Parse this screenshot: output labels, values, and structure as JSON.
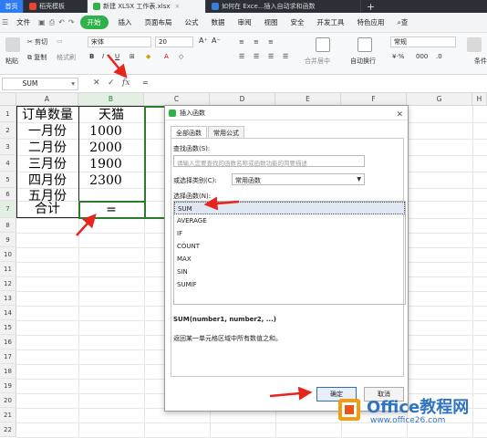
{
  "tabs": {
    "home": "首页",
    "templates": "稻壳模板",
    "workbook": "新建 XLSX 工作表.xlsx",
    "doc": "如何在 Exce...插入自动求和函数",
    "plus": "+"
  },
  "menu": {
    "file": "文件",
    "start": "开始",
    "items": [
      "插入",
      "页面布局",
      "公式",
      "数据",
      "审阅",
      "视图",
      "安全",
      "开发工具",
      "特色应用"
    ],
    "search": "查"
  },
  "ribbon": {
    "cut": "剪切",
    "copy": "复制",
    "format_painter": "格式刷",
    "paste": "粘贴",
    "font": "宋体",
    "size": "20",
    "merge": "合并居中",
    "wrap": "自动换行",
    "number_format": "常规",
    "fill": "条件"
  },
  "formula_bar": {
    "name_box": "SUM",
    "cancel": "✕",
    "confirm": "✓",
    "fx": "fx",
    "content": "="
  },
  "sheet": {
    "columns": [
      "A",
      "B",
      "C",
      "D",
      "E",
      "F",
      "G",
      "H"
    ],
    "rows": [
      "1",
      "2",
      "3",
      "4",
      "5",
      "6",
      "7",
      "8",
      "9",
      "10",
      "11",
      "12",
      "13",
      "14",
      "15",
      "16",
      "17",
      "18",
      "19",
      "20",
      "21",
      "22"
    ],
    "cells": {
      "A1": "订单数量",
      "B1": "天猫",
      "A2": "一月份",
      "B2": "1000",
      "A3": "二月份",
      "B3": "2000",
      "A4": "三月份",
      "B4": "1900",
      "A5": "四月份",
      "B5": "2300",
      "A6": "五月份",
      "A7": "合计",
      "B7": "="
    }
  },
  "dialog": {
    "title": "插入函数",
    "close": "✕",
    "tab_all": "全部函数",
    "tab_common": "常用公式",
    "search_label": "查找函数(S):",
    "search_placeholder": "请输入您要查找的函数名称或函数功能的简要描述",
    "category_label": "或选择类别(C):",
    "category_value": "常用函数",
    "select_label": "选择函数(N):",
    "functions": [
      "SUM",
      "AVERAGE",
      "IF",
      "COUNT",
      "MAX",
      "SIN",
      "SUMIF"
    ],
    "selected": "SUM",
    "signature": "SUM(number1, number2, ...)",
    "description": "返回某一单元格区域中所有数值之和。",
    "ok": "确定",
    "cancel": "取消"
  },
  "watermark": {
    "brand": "Office教程网",
    "url": "www.office26.com"
  },
  "colors": {
    "accent_green": "#2fb14b",
    "annotation_red": "#e8251c",
    "watermark_blue": "#2e74c2"
  }
}
